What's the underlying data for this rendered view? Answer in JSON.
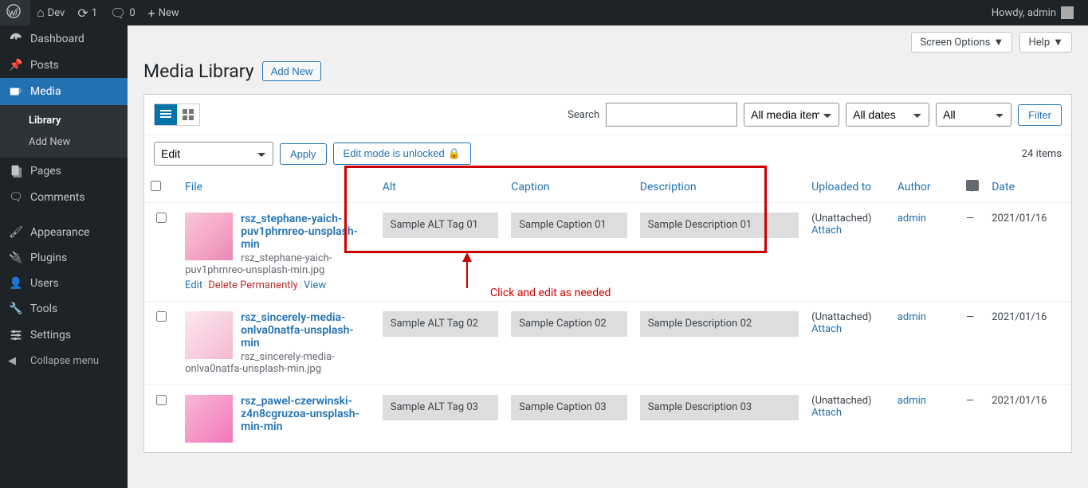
{
  "admin_bar": {
    "site": "Dev",
    "updates": "1",
    "comments": "0",
    "new": "New",
    "howdy": "Howdy, admin"
  },
  "sidebar": {
    "items": [
      {
        "label": "Dashboard"
      },
      {
        "label": "Posts"
      },
      {
        "label": "Media"
      },
      {
        "label": "Pages"
      },
      {
        "label": "Comments"
      },
      {
        "label": "Appearance"
      },
      {
        "label": "Plugins"
      },
      {
        "label": "Users"
      },
      {
        "label": "Tools"
      },
      {
        "label": "Settings"
      }
    ],
    "submenu": {
      "library": "Library",
      "addnew": "Add New"
    },
    "collapse": "Collapse menu"
  },
  "top_options": {
    "screen": "Screen Options",
    "help": "Help"
  },
  "heading": {
    "title": "Media Library",
    "add_new": "Add New"
  },
  "filters": {
    "search_label": "Search",
    "media_select": "All media items",
    "date_select": "All dates",
    "all_select": "All",
    "filter_btn": "Filter"
  },
  "bulk": {
    "action": "Edit",
    "apply": "Apply",
    "lock": "Edit mode is unlocked",
    "count": "24 items"
  },
  "columns": {
    "file": "File",
    "alt": "Alt",
    "caption": "Caption",
    "description": "Description",
    "uploaded": "Uploaded to",
    "author": "Author",
    "date": "Date"
  },
  "rows": [
    {
      "title": "rsz_stephane-yaich-puv1phrnreo-unsplash-min",
      "filename": "rsz_stephane-yaich-puv1phrnreo-unsplash-min.jpg",
      "alt": "Sample ALT Tag 01",
      "caption": "Sample Caption 01",
      "description": "Sample Description 01",
      "uploaded": "(Unattached)",
      "attach": "Attach",
      "author": "admin",
      "comments": "—",
      "date": "2021/01/16",
      "actions": {
        "edit": "Edit",
        "delete": "Delete Permanently",
        "view": "View"
      }
    },
    {
      "title": "rsz_sincerely-media-onlva0natfa-unsplash-min",
      "filename": "rsz_sincerely-media-onlva0natfa-unsplash-min.jpg",
      "alt": "Sample ALT Tag 02",
      "caption": "Sample Caption 02",
      "description": "Sample Description 02",
      "uploaded": "(Unattached)",
      "attach": "Attach",
      "author": "admin",
      "comments": "—",
      "date": "2021/01/16"
    },
    {
      "title": "rsz_pawel-czerwinski-z4n8cgruzoa-unsplash-min-min",
      "filename": "",
      "alt": "Sample ALT Tag 03",
      "caption": "Sample Caption 03",
      "description": "Sample Description 03",
      "uploaded": "(Unattached)",
      "attach": "Attach",
      "author": "admin",
      "comments": "—",
      "date": "2021/01/16"
    }
  ],
  "annotation": "Click and edit as needed"
}
